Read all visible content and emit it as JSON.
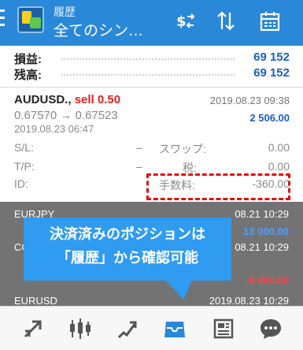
{
  "header": {
    "subtitle": "履歴",
    "title": "全てのシン…",
    "actions": [
      "currency-filter-icon",
      "sort-icon",
      "calendar-icon"
    ]
  },
  "summary": {
    "profit_label": "損益:",
    "profit_value": "69 152",
    "balance_label": "残高:",
    "balance_value": "69 152"
  },
  "trade": {
    "symbol": "AUDUSD.,",
    "side": "sell 0.50",
    "close_time": "2019.08.23 09:38",
    "price": "0.67570 → 0.67523",
    "profit": "2 506.00",
    "open_time": "2019.08.23 06:47",
    "sl_label": "S/L:",
    "sl_value": "–",
    "tp_label": "T/P:",
    "tp_value": "–",
    "id_label": "ID:",
    "swap_label": "スワップ:",
    "swap_value": "0.00",
    "tax_label": "税:",
    "tax_value": "0.00",
    "fee_label": "手数料:",
    "fee_value": "-360.00"
  },
  "background_rows": [
    {
      "symbol": "EURJPY",
      "date": "08.21 10:29",
      "profit": "13 000.00",
      "profit_color": "blue"
    },
    {
      "symbol": "CGO",
      "date": "08.21 10:29",
      "profit": "-9 000.00",
      "profit_color": "red"
    },
    {
      "symbol": "EURUSD",
      "date": "2019.08.23 10:29",
      "profit": "",
      "profit_color": ""
    }
  ],
  "callout": {
    "line1": "決済済みのポジションは",
    "line2": "「履歴」から確認可能"
  },
  "bottom_nav": [
    "trade-icon",
    "chart-icon",
    "quotes-icon",
    "history-icon",
    "news-icon",
    "chat-icon"
  ],
  "colors": {
    "appbar": "#2a88d8",
    "accent_blue": "#1a5fc4",
    "sell_red": "#e02020",
    "highlight_red": "#e01010",
    "callout_blue": "#2f9bf1"
  }
}
